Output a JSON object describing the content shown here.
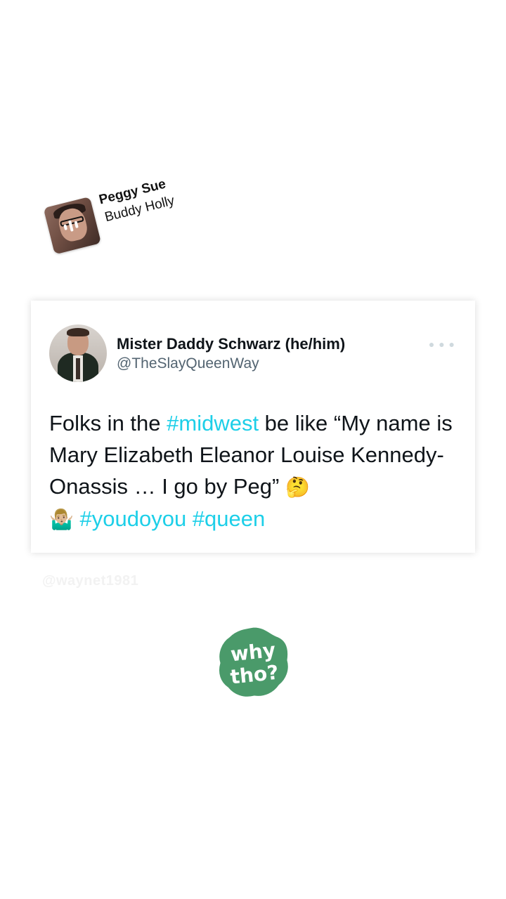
{
  "music_sticker": {
    "song_title": "Peggy Sue",
    "artist": "Buddy Holly",
    "album_art_icon": "album-cover-with-sound-wave"
  },
  "tweet": {
    "display_name": "Mister Daddy Schwarz (he/him)",
    "handle": "@TheSlayQueenWay",
    "more_icon": "more-dots-icon",
    "text_parts": {
      "p1": "Folks in the ",
      "tag1": "#midwest",
      "p2": " be like “My name is Mary Elizabeth Eleanor Louise Kennedy-Onassis … I go by Peg” ",
      "emoji1": "🤔",
      "emoji2": "🤷🏼‍♂️",
      "tag2": "#youdoyou",
      "tag3": "#queen"
    },
    "hashtag_color": "#1dcfe8"
  },
  "watermark": "@waynet1981",
  "why_sticker": {
    "line1": "why",
    "line2": "tho?",
    "color": "#4a9a6a"
  }
}
